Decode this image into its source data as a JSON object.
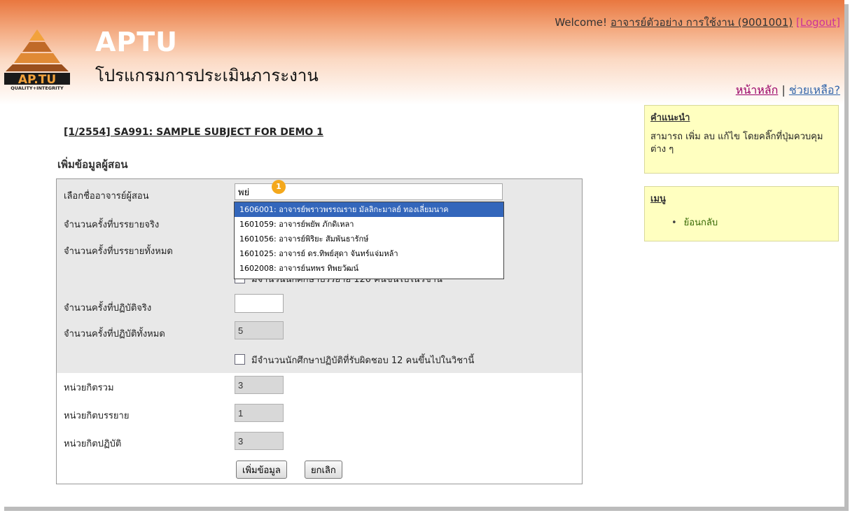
{
  "header": {
    "app_name": "APTU",
    "app_subtitle": "โปรแกรมการประเมินภาระงาน",
    "logo_text": "AP.TU",
    "logo_tagline": "QUALITY+INTEGRITY",
    "welcome_prefix": "Welcome!",
    "user_name": "อาจารย์ตัวอย่าง การใช้งาน (9001001)",
    "logout_label": "[Logout]",
    "home_link": "หน้าหลัก",
    "separator": "|",
    "help_link": "ช่วยเหลือ?"
  },
  "main": {
    "subject_title": "[1/2554] SA991: SAMPLE SUBJECT FOR DEMO 1",
    "section_title": "เพิ่มข้อมูลผู้สอน"
  },
  "form": {
    "instructor_label": "เลือกชื่ออาจารย์ผู้สอน",
    "instructor_value": "พย่",
    "lecture_actual_label": "จำนวนครั้งที่บรรยายจริง",
    "lecture_total_label": "จำนวนครั้งที่บรรยายทั้งหมด",
    "lecture_checkbox_label": "มีจำนวนนักศึกษาบรรยาย 120 คนขึ้นไปในวิชานี้",
    "practice_actual_label": "จำนวนครั้งที่ปฏิบัติจริง",
    "practice_actual_value": "",
    "practice_total_label": "จำนวนครั้งที่ปฏิบัติทั้งหมด",
    "practice_total_value": "5",
    "practice_checkbox_label": "มีจำนวนนักศึกษาปฏิบัติที่รับผิดชอบ 12 คนขึ้นไปในวิชานี้",
    "credit_total_label": "หน่วยกิตรวม",
    "credit_total_value": "3",
    "credit_lecture_label": "หน่วยกิตบรรยาย",
    "credit_lecture_value": "1",
    "credit_practice_label": "หน่วยกิตปฏิบัติ",
    "credit_practice_value": "3",
    "submit_label": "เพิ่มข้อมูล",
    "cancel_label": "ยกเลิก"
  },
  "autocomplete": {
    "badge": "1",
    "options": [
      "1606001: อาจารย์พราวพรรณราย มัลลิกะมาลย์ ทองเลี่ยมนาค",
      "1601059: อาจารย์พยัพ ภักดิเหลา",
      "1601056: อาจารย์พิริยะ สัมพันธารักษ์",
      "1601025: อาจารย์ ดร.ทิพย์สุดา จันทร์แจ่มหล้า",
      "1602008: อาจารย์นทพร ทิพยวัฒน์"
    ]
  },
  "sidebar": {
    "advice_title": "คำแนะนำ",
    "advice_text": "สามารถ เพิ่ม ลบ แก้ไข โดยคลิ๊กที่ปุ่มควบคุมต่าง ๆ",
    "menu_title": "เมนู",
    "menu_items": [
      "ย้อนกลับ"
    ]
  },
  "colors": {
    "header_orange": "#e9773f",
    "side_box_yellow": "#ffffc0",
    "selected_option": "#3366bb",
    "badge": "#f4a81c"
  }
}
